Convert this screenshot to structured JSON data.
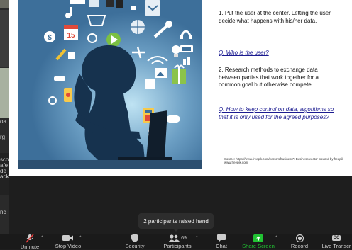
{
  "left_panel": {
    "line1": "oa",
    "line2": "rg",
    "line3": "sco\nafe\nde\nack",
    "line4": "nc"
  },
  "slide": {
    "point1": "1. Put the user at the center. Letting the user decide what happens with his/her data.",
    "q1": "Q: Who is the user?",
    "point2": "2. Research methods to exchange data between parties that work together for a common goal but otherwise compete.",
    "q2": "Q: How to keep control on data, algorithms so that it is only used for the agreed purposes?",
    "source": "Source: https://www.freepik.com/vectors/business\">Business vector created by freepik - www.freepik.com",
    "calendar_number": "15"
  },
  "tooltip": {
    "text": "2 participants raised hand"
  },
  "toolbar": {
    "unmute": "Unmute",
    "stop_video": "Stop Video",
    "security": "Security",
    "participants": "Participants",
    "participants_count": "69",
    "chat": "Chat",
    "share_screen": "Share Screen",
    "record": "Record",
    "live_transcript": "Live Transcr",
    "cc": "CC"
  },
  "colors": {
    "accent_green": "#21c233",
    "muted_red": "#e23b3b",
    "slide_bg_blue": "#3d6f9a",
    "toolbar_bg": "#1a1a1a"
  }
}
